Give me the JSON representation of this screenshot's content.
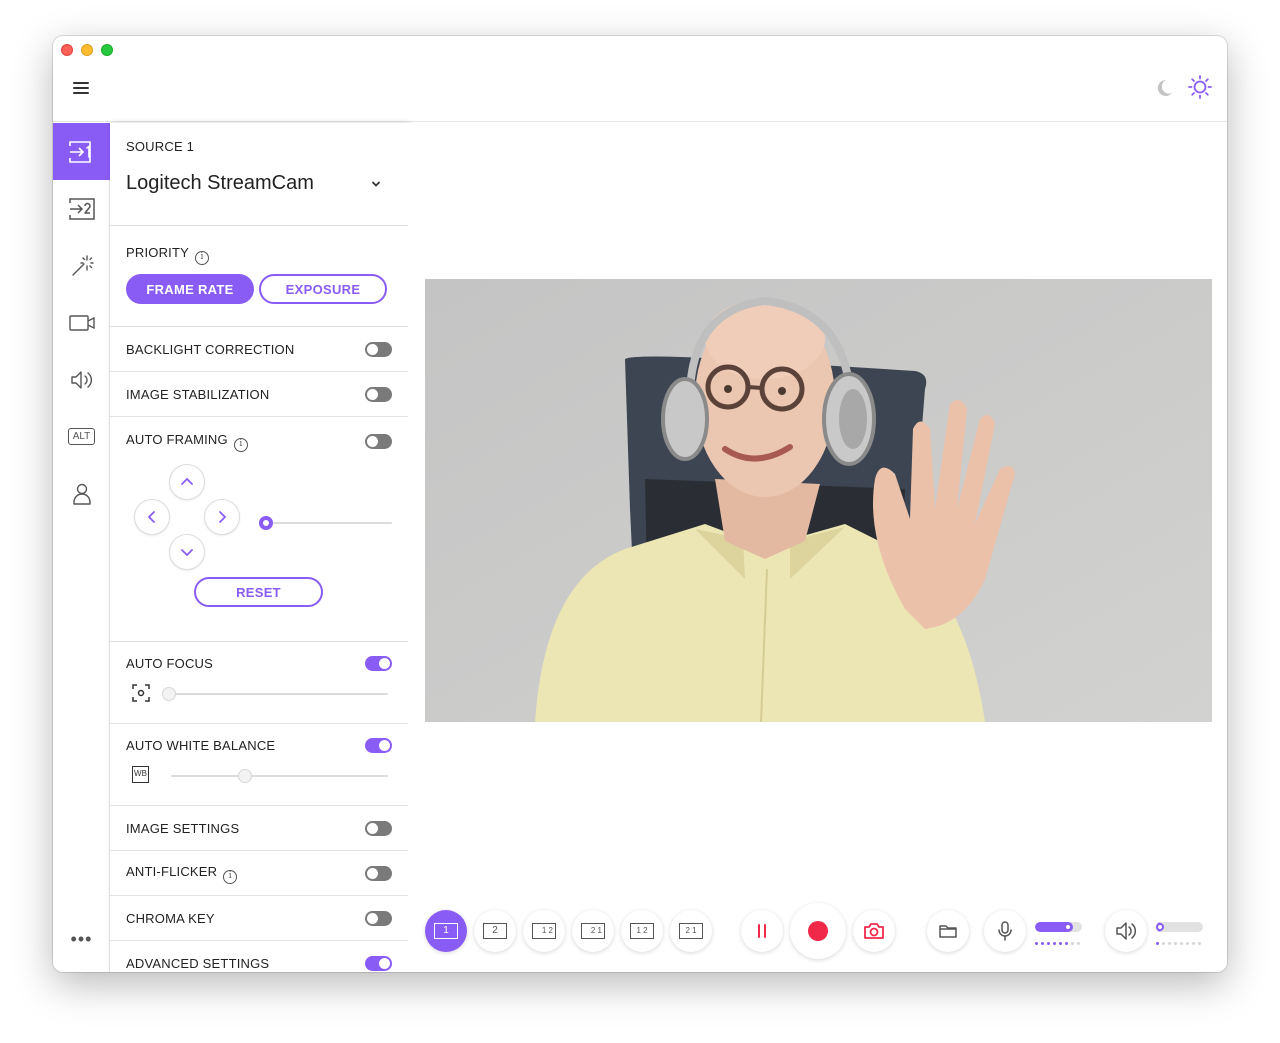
{
  "colors": {
    "accent": "#8a5cf6",
    "record": "#f0294b"
  },
  "topbar": {
    "menu_icon": "hamburger-icon",
    "dark_mode_icon": "moon-icon",
    "light_mode_icon": "sun-icon"
  },
  "sidebar": {
    "items": [
      {
        "name": "source-1",
        "icon": "source-1-icon",
        "active": true
      },
      {
        "name": "source-2",
        "icon": "source-2-icon"
      },
      {
        "name": "effects",
        "icon": "magic-wand-icon"
      },
      {
        "name": "camera",
        "icon": "camera-icon"
      },
      {
        "name": "audio",
        "icon": "speaker-icon"
      },
      {
        "name": "alt",
        "icon": "alt-icon",
        "text": "ALT"
      },
      {
        "name": "account",
        "icon": "user-icon"
      }
    ],
    "more_label": "•••"
  },
  "panel": {
    "source": {
      "label": "SOURCE 1",
      "device": "Logitech StreamCam"
    },
    "priority": {
      "label": "PRIORITY",
      "info": "i",
      "frame_rate": "FRAME RATE",
      "exposure": "EXPOSURE",
      "selected": "FRAME RATE"
    },
    "backlight": {
      "label": "BACKLIGHT CORRECTION",
      "on": false
    },
    "stabilization": {
      "label": "IMAGE STABILIZATION",
      "on": false
    },
    "auto_framing": {
      "label": "AUTO FRAMING",
      "info": "i",
      "on": false,
      "zoom": 0.0,
      "reset_label": "RESET"
    },
    "auto_focus": {
      "label": "AUTO FOCUS",
      "on": true,
      "level": 0.0
    },
    "auto_white_balance": {
      "label": "AUTO WHITE BALANCE",
      "on": true,
      "level": 0.35,
      "icon_text": "WB"
    },
    "image_settings": {
      "label": "IMAGE SETTINGS",
      "on": false
    },
    "anti_flicker": {
      "label": "ANTI-FLICKER",
      "info": "i",
      "on": false
    },
    "chroma_key": {
      "label": "CHROMA KEY",
      "on": false
    },
    "advanced": {
      "label": "ADVANCED SETTINGS",
      "on": true
    }
  },
  "bottombar": {
    "layouts": [
      {
        "name": "layout-single-1",
        "label": "1",
        "active": true
      },
      {
        "name": "layout-single-2",
        "label": "2"
      },
      {
        "name": "layout-pip-1-2",
        "label": "1 2"
      },
      {
        "name": "layout-pip-2-1",
        "label": "2 1"
      },
      {
        "name": "layout-split-1-2",
        "label": "1 2"
      },
      {
        "name": "layout-split-2-1",
        "label": "2 1"
      }
    ],
    "mic_level": 0.8,
    "speaker_level": 0.1
  }
}
